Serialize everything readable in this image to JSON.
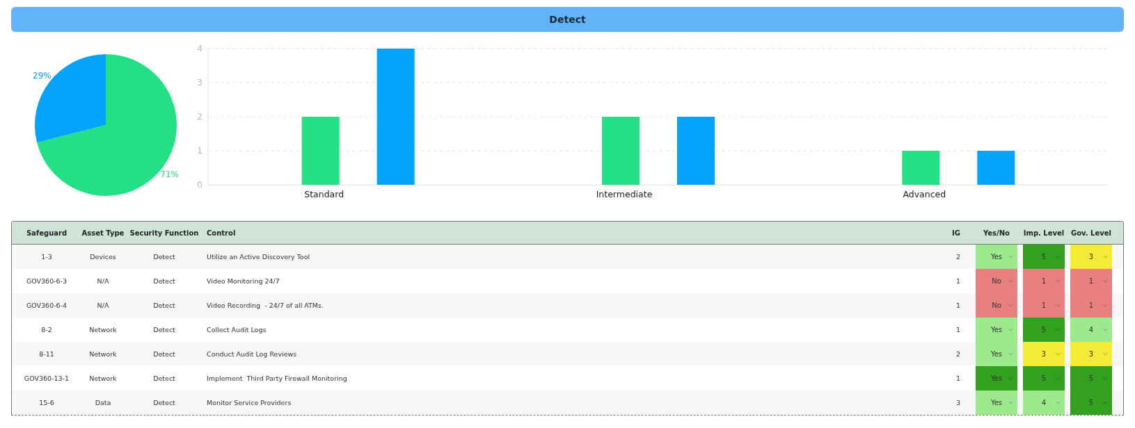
{
  "section_header": {
    "title": "Detect"
  },
  "pie_chart": {
    "chart_data": {
      "type": "pie",
      "values": [
        71,
        29
      ],
      "colors": [
        "#24e084",
        "#06a3fb"
      ],
      "value_labels": [
        "71%",
        "29%"
      ]
    }
  },
  "bar_chart": {
    "chart_data": {
      "type": "bar",
      "categories": [
        "Standard",
        "Intermediate",
        "Advanced"
      ],
      "ylim": [
        0,
        4
      ],
      "grid": true,
      "yticks": [
        0,
        1,
        2,
        3,
        4
      ],
      "series": [
        {
          "color": "#24e084",
          "values": [
            2,
            2,
            1
          ]
        },
        {
          "color": "#06a3fb",
          "values": [
            4,
            2,
            1
          ]
        }
      ]
    }
  },
  "table": {
    "columns": [
      "Safeguard",
      "Asset Type",
      "Security Function",
      "Control",
      "IG",
      "Yes/No",
      "Imp. Level",
      "Gov. Level"
    ],
    "rows": [
      {
        "safeguard": "1-3",
        "asset_type": "Devices",
        "security_function": "Detect",
        "control": "Utilize an Active Discovery Tool",
        "ig": "2",
        "yes_no": {
          "value": "Yes",
          "color": "#9de98e"
        },
        "imp_level": {
          "value": "5",
          "color": "#33a11f"
        },
        "gov_level": {
          "value": "3",
          "color": "#f3eb35"
        }
      },
      {
        "safeguard": "GOV360-6-3",
        "asset_type": "N/A",
        "security_function": "Detect",
        "control": "Video Monitoring 24/7",
        "ig": "1",
        "yes_no": {
          "value": "No",
          "color": "#e88080"
        },
        "imp_level": {
          "value": "1",
          "color": "#e88080"
        },
        "gov_level": {
          "value": "1",
          "color": "#e88080"
        }
      },
      {
        "safeguard": "GOV360-6-4",
        "asset_type": "N/A",
        "security_function": "Detect",
        "control": "Video Recording  - 24/7 of all ATMs.",
        "ig": "1",
        "yes_no": {
          "value": "No",
          "color": "#e88080"
        },
        "imp_level": {
          "value": "1",
          "color": "#e88080"
        },
        "gov_level": {
          "value": "1",
          "color": "#e88080"
        }
      },
      {
        "safeguard": "8-2",
        "asset_type": "Network",
        "security_function": "Detect",
        "control": "Collect Audit Logs",
        "ig": "1",
        "yes_no": {
          "value": "Yes",
          "color": "#9de98e"
        },
        "imp_level": {
          "value": "5",
          "color": "#33a11f"
        },
        "gov_level": {
          "value": "4",
          "color": "#9de98e"
        }
      },
      {
        "safeguard": "8-11",
        "asset_type": "Network",
        "security_function": "Detect",
        "control": "Conduct Audit Log Reviews",
        "ig": "2",
        "yes_no": {
          "value": "Yes",
          "color": "#9de98e"
        },
        "imp_level": {
          "value": "3",
          "color": "#f3eb35"
        },
        "gov_level": {
          "value": "3",
          "color": "#f3eb35"
        }
      },
      {
        "safeguard": "GOV360-13-1",
        "asset_type": "Network",
        "security_function": "Detect",
        "control": "Implement  Third Party Firewall Monitoring",
        "ig": "1",
        "yes_no": {
          "value": "Yes",
          "color": "#33a11f"
        },
        "imp_level": {
          "value": "5",
          "color": "#33a11f"
        },
        "gov_level": {
          "value": "5",
          "color": "#33a11f"
        }
      },
      {
        "safeguard": "15-6",
        "asset_type": "Data",
        "security_function": "Detect",
        "control": "Monitor Service Providers",
        "ig": "3",
        "yes_no": {
          "value": "Yes",
          "color": "#9de98e"
        },
        "imp_level": {
          "value": "4",
          "color": "#9de98e"
        },
        "gov_level": {
          "value": "5",
          "color": "#33a11f"
        }
      }
    ]
  }
}
